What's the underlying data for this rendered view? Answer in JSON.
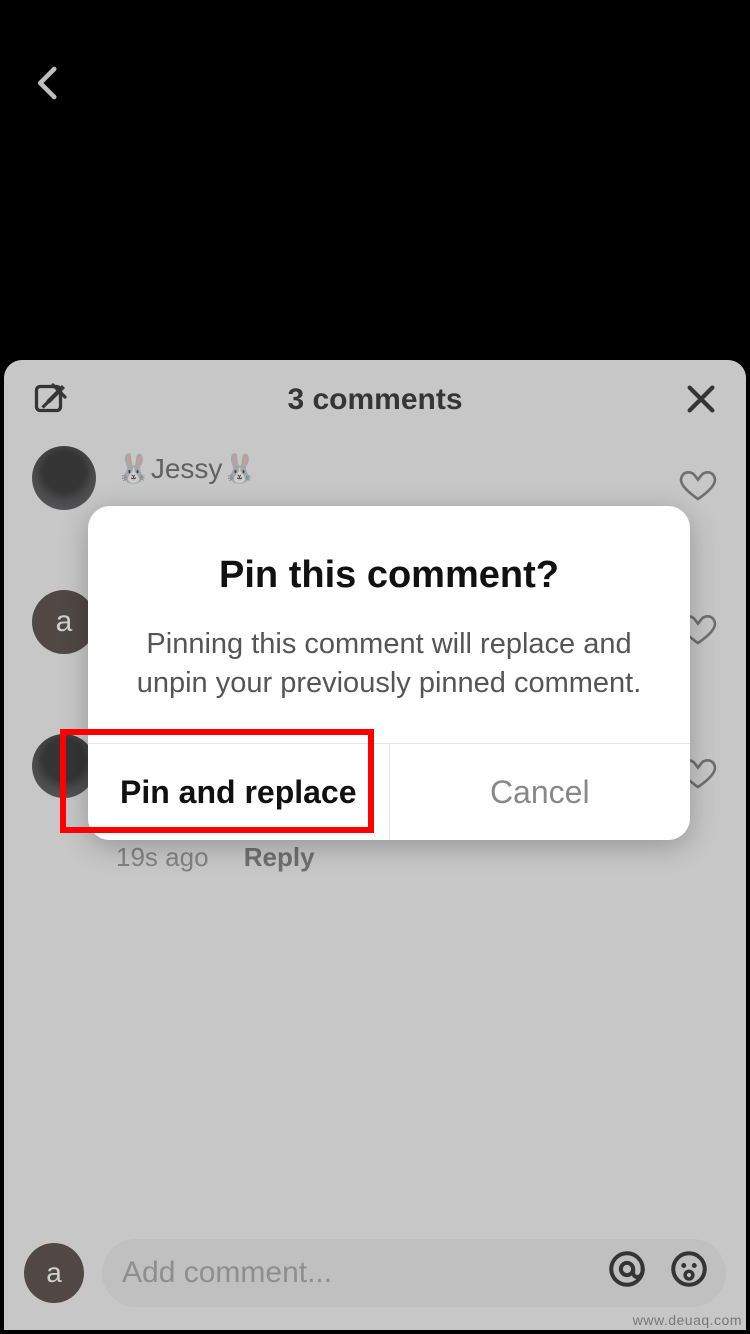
{
  "sheet": {
    "title": "3 comments",
    "compose_label": "compose",
    "close_label": "close"
  },
  "comments": [
    {
      "username": "🐰Jessy🐰"
    },
    {
      "username": ""
    },
    {
      "username": "",
      "timestamp": "19s ago",
      "reply_label": "Reply"
    }
  ],
  "dialog": {
    "title": "Pin this comment?",
    "description": "Pinning this comment will replace and unpin your previously pinned comment.",
    "primary": "Pin and replace",
    "secondary": "Cancel"
  },
  "input": {
    "avatar_letter": "a",
    "placeholder": "Add comment..."
  },
  "watermark": "www.deuaq.com"
}
